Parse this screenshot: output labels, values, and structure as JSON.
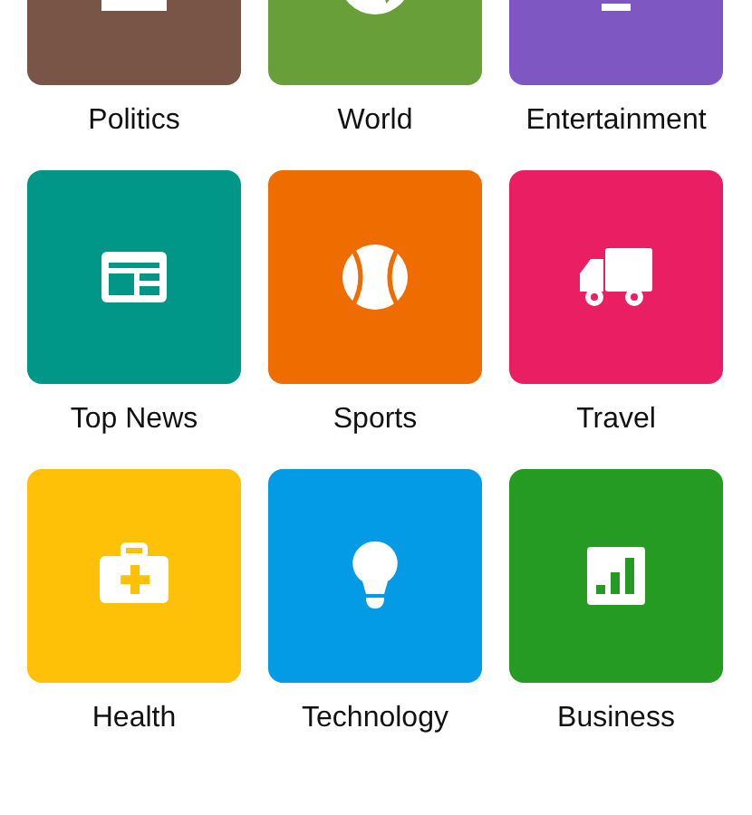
{
  "categories": [
    {
      "label": "Politics",
      "kind": "politics",
      "color": "#795548"
    },
    {
      "label": "World",
      "kind": "world",
      "color": "#689f38"
    },
    {
      "label": "Entertainment",
      "kind": "entertainment",
      "color": "#7e57c2"
    },
    {
      "label": "Top News",
      "kind": "news",
      "color": "#009688"
    },
    {
      "label": "Sports",
      "kind": "sports",
      "color": "#ef6c00"
    },
    {
      "label": "Travel",
      "kind": "travel",
      "color": "#e91e63"
    },
    {
      "label": "Health",
      "kind": "health",
      "color": "#ffc107"
    },
    {
      "label": "Technology",
      "kind": "technology",
      "color": "#039be5"
    },
    {
      "label": "Business",
      "kind": "business",
      "color": "#259b24"
    }
  ]
}
